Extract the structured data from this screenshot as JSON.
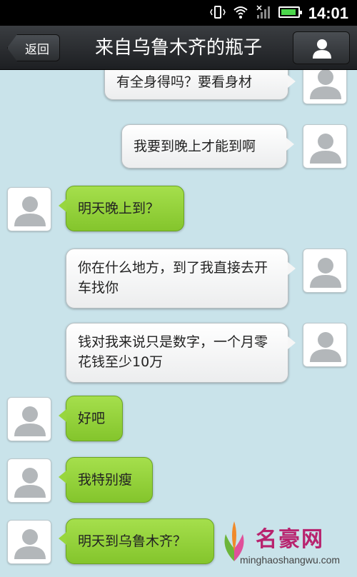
{
  "status_bar": {
    "time": "14:01"
  },
  "header": {
    "back_label": "返回",
    "title": "来自乌鲁木齐的瓶子"
  },
  "messages": [
    {
      "side": "right",
      "text": "有全身得吗？要看身材"
    },
    {
      "side": "right",
      "text": "我要到晚上才能到啊"
    },
    {
      "side": "left",
      "text": "明天晚上到？"
    },
    {
      "side": "right",
      "text": "你在什么地方，到了我直接去开车找你"
    },
    {
      "side": "right",
      "text": "钱对我来说只是数字，一个月零花钱至少10万"
    },
    {
      "side": "left",
      "text": "好吧"
    },
    {
      "side": "left",
      "text": "我特别瘦"
    },
    {
      "side": "left",
      "text": "明天到乌鲁木齐？"
    }
  ],
  "watermark": {
    "name": "名豪网",
    "url": "minghaoshangwu.com"
  },
  "colors": {
    "chat_bg": "#c9e3ea",
    "incoming_bubble": "#98d63e",
    "outgoing_bubble": "#f6f6f6",
    "header_bg": "#2b2e31"
  }
}
